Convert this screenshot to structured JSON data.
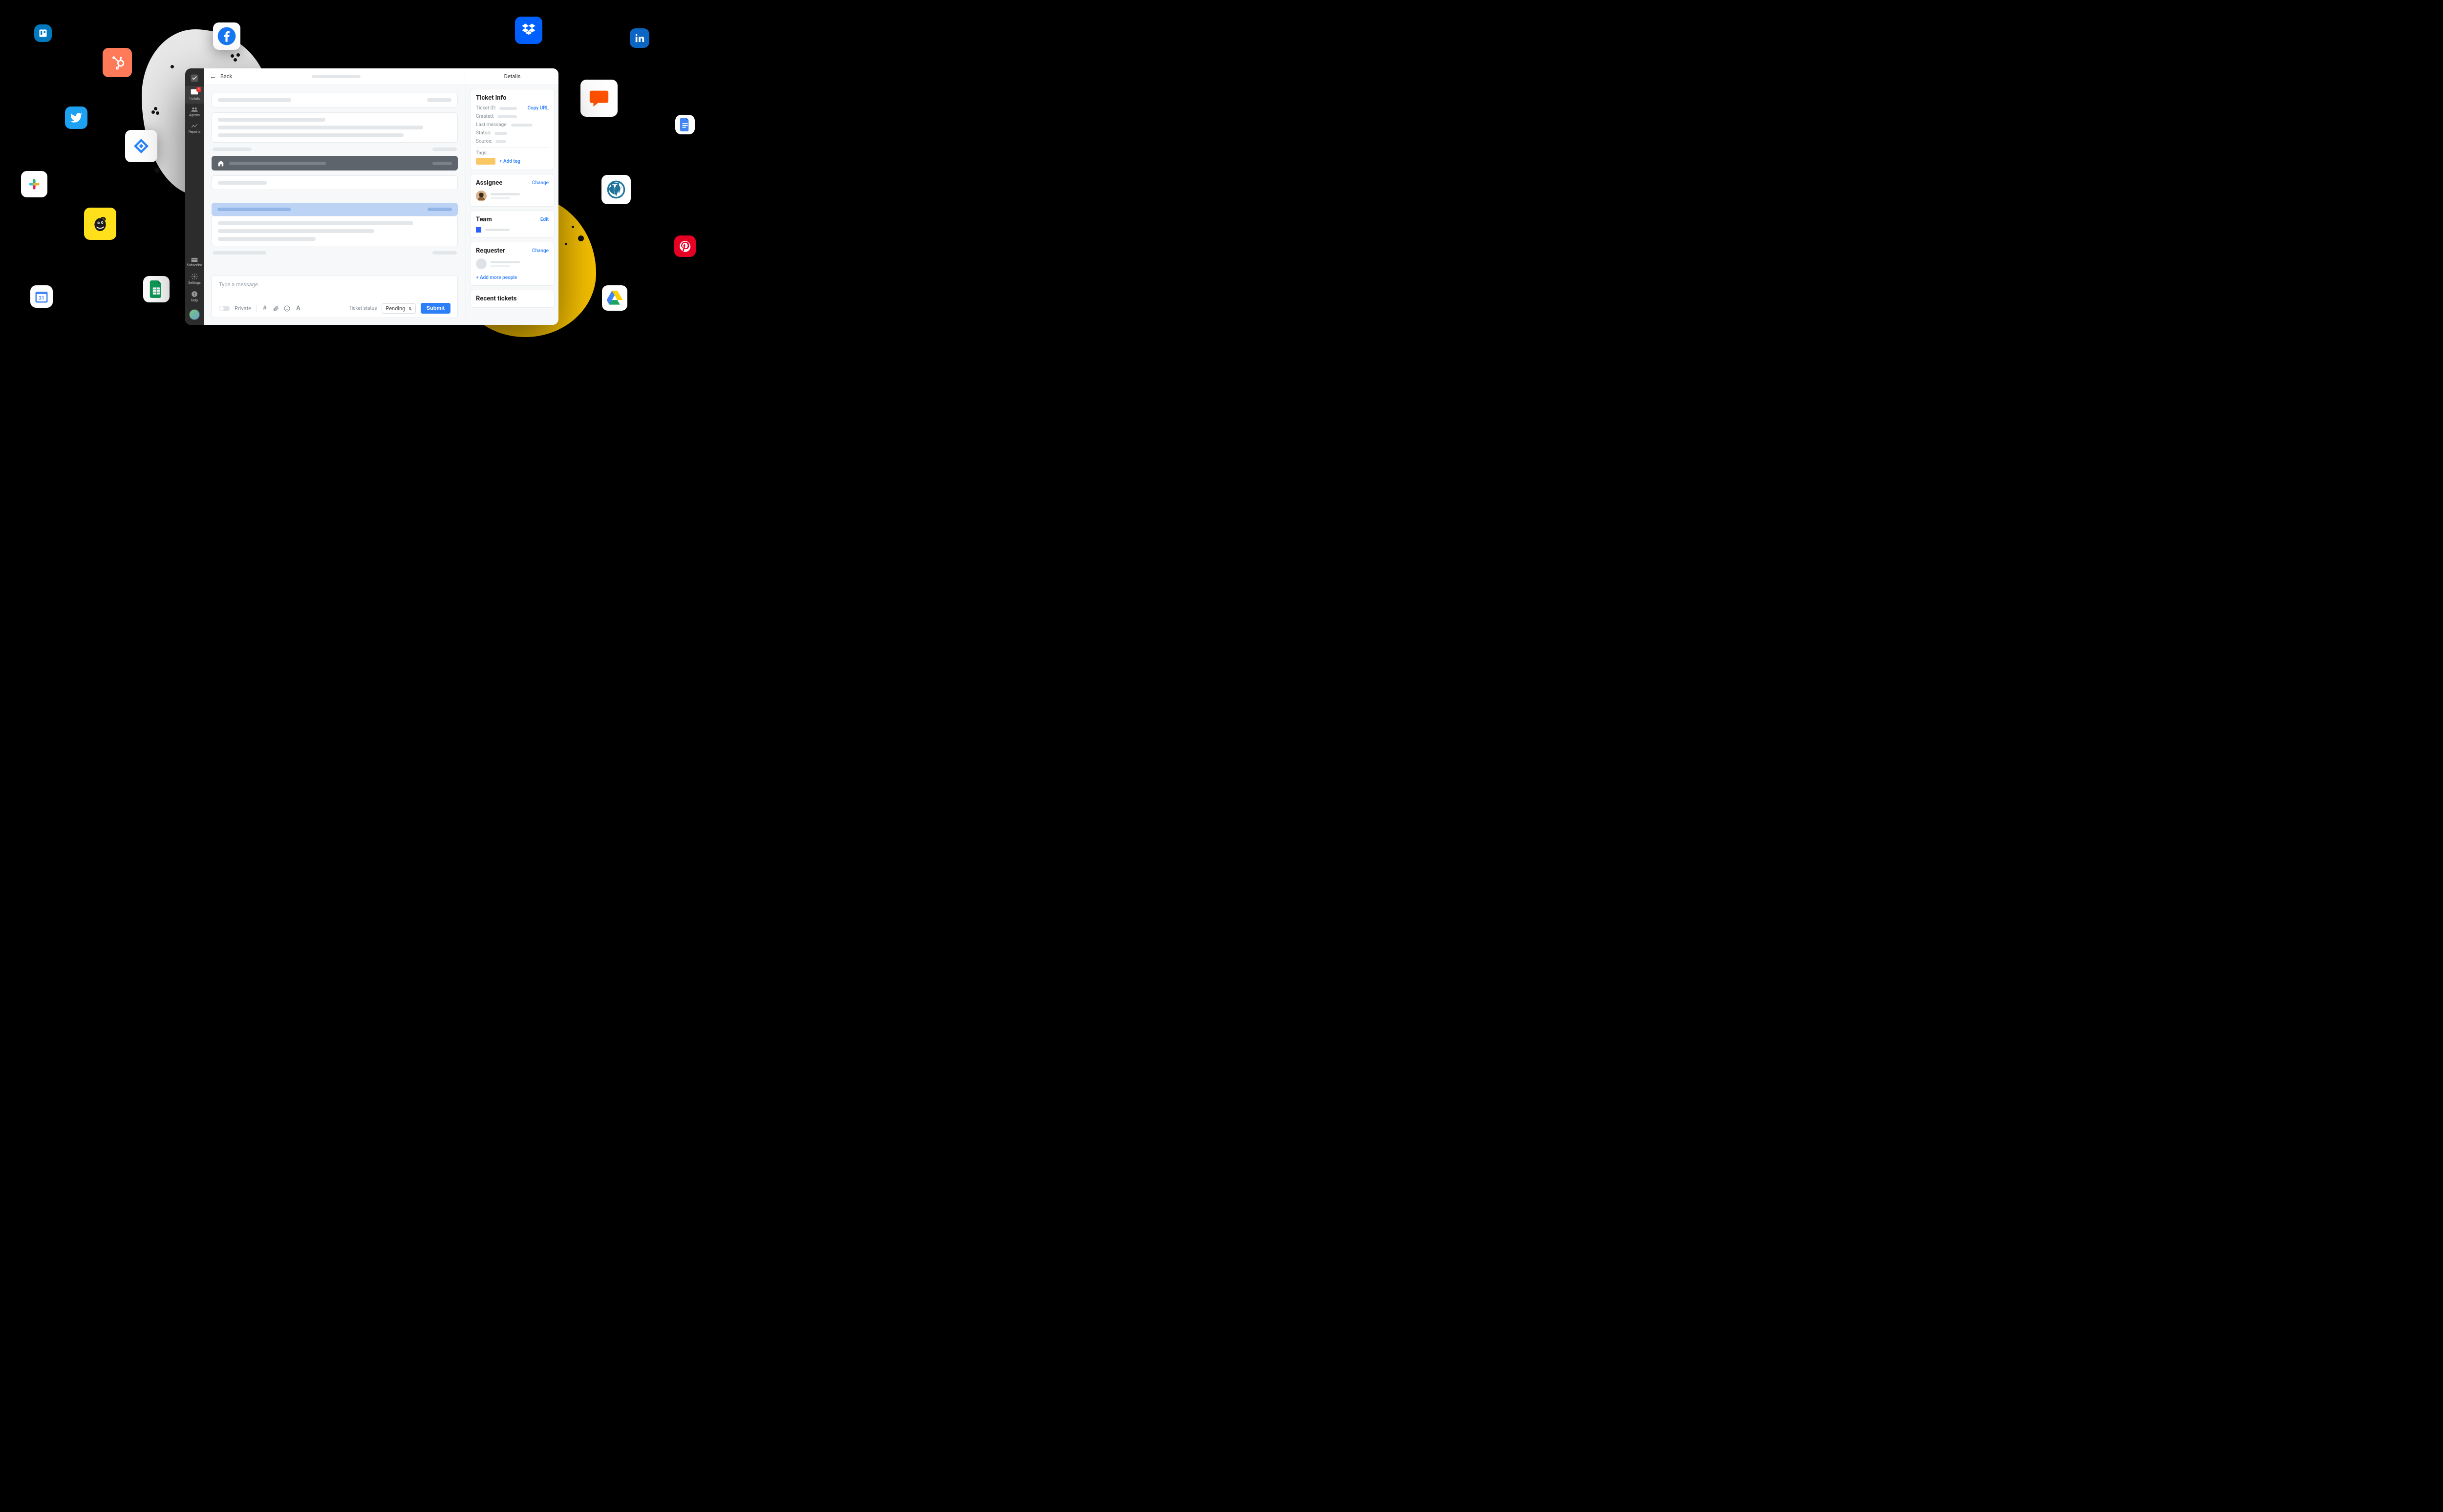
{
  "header": {
    "back_label": "Back",
    "details_label": "Details"
  },
  "sidebar": {
    "items": [
      {
        "label": "Tickets",
        "badge": "1"
      },
      {
        "label": "Agents"
      },
      {
        "label": "Reports"
      }
    ],
    "bottom": [
      {
        "label": "Subscribe"
      },
      {
        "label": "Settings"
      },
      {
        "label": "Help"
      }
    ]
  },
  "composer": {
    "placeholder": "Type a message...",
    "private_label": "Private",
    "status_label": "Ticket status",
    "status_value": "Pending",
    "submit_label": "Submit"
  },
  "details": {
    "ticket_info": {
      "title": "Ticket info",
      "fields": {
        "ticket_id": "Ticket ID:",
        "created": "Created:",
        "last_message": "Last message:",
        "status": "Status:",
        "source": "Source:"
      },
      "copy_url": "Copy URL",
      "tags_label": "Tags:",
      "add_tag": "+ Add tag"
    },
    "assignee": {
      "title": "Assignee",
      "action": "Change"
    },
    "team": {
      "title": "Team",
      "action": "Edit"
    },
    "requester": {
      "title": "Requester",
      "action": "Change",
      "add_more": "+ Add more people"
    },
    "recent": {
      "title": "Recent tickets"
    }
  },
  "integrations": {
    "trello": "trello-icon",
    "hubspot": "hubspot-icon",
    "facebook": "facebook-icon",
    "twitter": "twitter-icon",
    "jira": "jira-icon",
    "slack": "slack-icon",
    "mailchimp": "mailchimp-icon",
    "google_sheets": "google-sheets-icon",
    "google_calendar": "google-calendar-icon",
    "dropbox": "dropbox-icon",
    "linkedin": "linkedin-icon",
    "livechat": "livechat-icon",
    "google_docs": "google-docs-icon",
    "wordpress": "wordpress-icon",
    "pinterest": "pinterest-icon",
    "google_drive": "google-drive-icon",
    "calendar_day": "31"
  }
}
